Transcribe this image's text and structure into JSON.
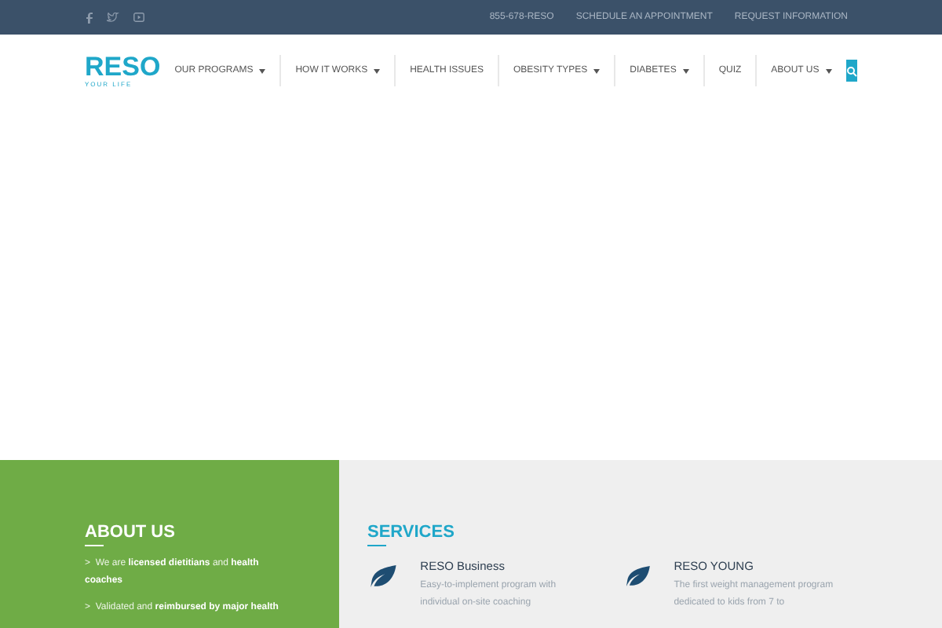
{
  "top_bar": {
    "links": [
      "855-678-RESO",
      "SCHEDULE AN APPOINTMENT",
      "REQUEST INFORMATION"
    ]
  },
  "logo": {
    "name": "RESO",
    "tagline": "YOUR LIFE"
  },
  "nav": [
    {
      "label": "OUR PROGRAMS",
      "dropdown": true
    },
    {
      "label": "HOW IT WORKS",
      "dropdown": true
    },
    {
      "label": "HEALTH ISSUES",
      "dropdown": false
    },
    {
      "label": "OBESITY TYPES",
      "dropdown": true
    },
    {
      "label": "DIABETES",
      "dropdown": true
    },
    {
      "label": "QUIZ",
      "dropdown": false
    },
    {
      "label": "ABOUT US",
      "dropdown": true
    }
  ],
  "about": {
    "title": "ABOUT US",
    "items": [
      ">  We are **licensed dietitians** and **health coaches**",
      ">  Validated and **reimbursed by major health**"
    ]
  },
  "services": {
    "title": "SERVICES",
    "items": [
      {
        "title": "RESO Business",
        "text": "Easy-to-implement program with individual on-site coaching"
      },
      {
        "title": "RESO YOUNG",
        "text": "The first weight management program dedicated to kids from 7 to"
      }
    ]
  }
}
